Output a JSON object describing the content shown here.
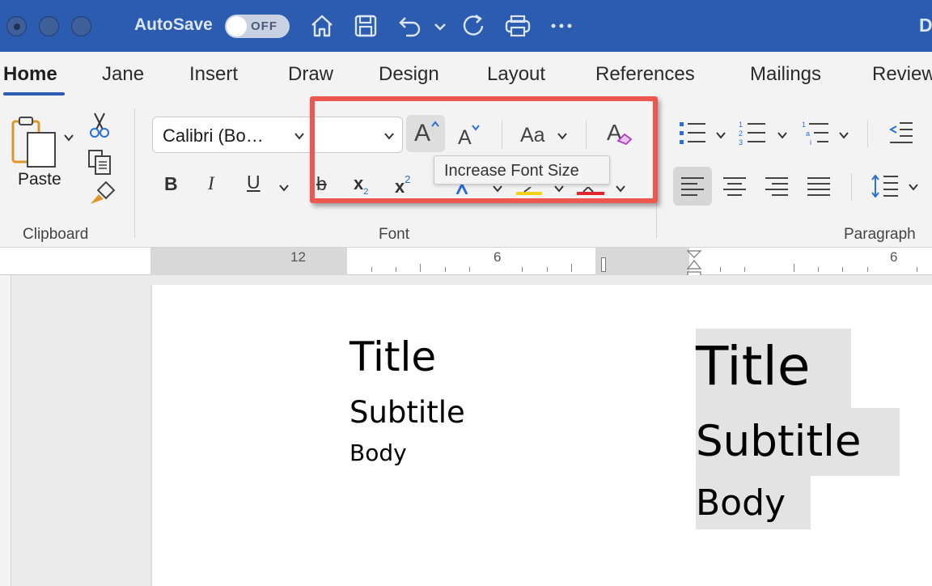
{
  "titlebar": {
    "autosave_label": "AutoSave",
    "autosave_state": "OFF",
    "doc_initial": "D",
    "icons": [
      "home-icon",
      "save-icon",
      "undo-icon",
      "chevron-down-icon",
      "redo-icon",
      "print-icon",
      "more-icon"
    ],
    "colors": {
      "bar": "#2b5cb0",
      "text": "#dbe5f6"
    }
  },
  "tabs": {
    "items": [
      "Home",
      "Jane",
      "Insert",
      "Draw",
      "Design",
      "Layout",
      "References",
      "Mailings",
      "Review"
    ],
    "active": "Home"
  },
  "ribbon": {
    "clipboard": {
      "paste_label": "Paste",
      "group_label": "Clipboard"
    },
    "font": {
      "font_name": "Calibri (Bo…",
      "font_size": "",
      "group_label": "Font",
      "tooltip": "Increase Font Size",
      "buttons": {
        "bold": "B",
        "italic": "I",
        "underline": "U",
        "strike": "b",
        "subscript": "x",
        "subscript_mark": "2",
        "superscript": "x",
        "superscript_mark": "2",
        "grow": "A",
        "shrink": "A",
        "change_case": "Aa",
        "clear_formatting": "A"
      }
    },
    "paragraph": {
      "group_label": "Paragraph"
    },
    "colors": {
      "highlight_box": "#ee5650",
      "accent_blue": "#2b6fd6",
      "background": "#f3f3f3"
    }
  },
  "ruler": {
    "labels": [
      "12",
      "6",
      "6"
    ]
  },
  "document": {
    "left_block": {
      "title": "Title",
      "subtitle": "Subtitle",
      "body": "Body"
    },
    "right_block": {
      "title": "Title",
      "subtitle": "Subtitle",
      "body": "Body"
    }
  }
}
